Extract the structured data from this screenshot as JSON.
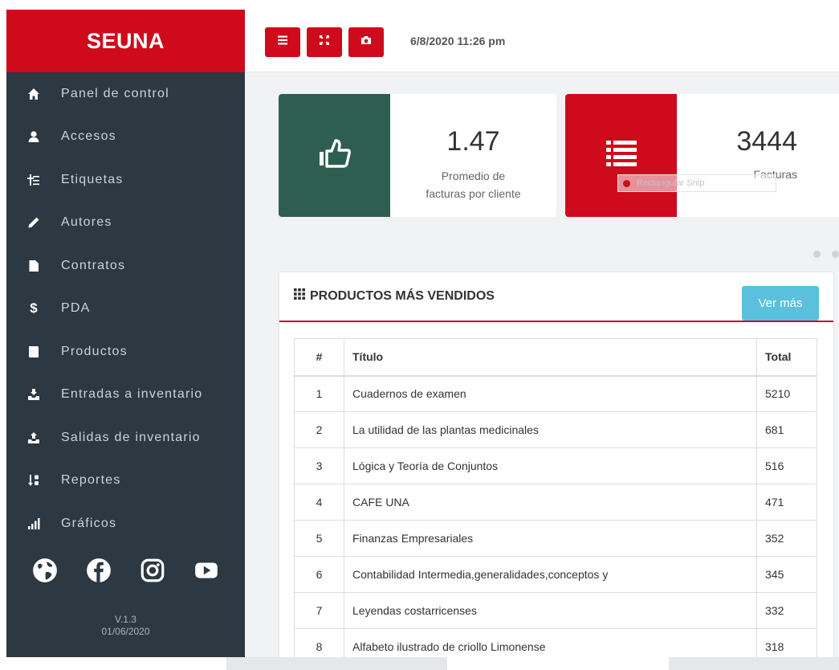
{
  "brand": {
    "name": "SEUNA"
  },
  "sidebar": {
    "items": [
      {
        "label": "Panel de control",
        "icon": "home-icon"
      },
      {
        "label": "Accesos",
        "icon": "user-icon"
      },
      {
        "label": "Etiquetas",
        "icon": "tag-icon"
      },
      {
        "label": "Autores",
        "icon": "pencil-icon"
      },
      {
        "label": "Contratos",
        "icon": "file-icon"
      },
      {
        "label": "PDA",
        "icon": "dollar-icon"
      },
      {
        "label": "Productos",
        "icon": "book-icon"
      },
      {
        "label": "Entradas a inventario",
        "icon": "inbox-in-icon"
      },
      {
        "label": "Salidas de inventario",
        "icon": "inbox-out-icon"
      },
      {
        "label": "Reportes",
        "icon": "sort-icon"
      },
      {
        "label": "Gráficos",
        "icon": "bar-chart-icon"
      }
    ],
    "social": [
      "globe-icon",
      "facebook-icon",
      "instagram-icon",
      "youtube-icon"
    ],
    "version": "V.1.3",
    "version_date": "01/06/2020"
  },
  "topbar": {
    "buttons": [
      "menu-icon",
      "expand-icon",
      "camera-icon"
    ],
    "datetime": "6/8/2020 11:26 pm"
  },
  "cards": [
    {
      "value": "1.47",
      "caption_line1": "Promedio de",
      "caption_line2": "facturas por cliente",
      "icon": "thumbs-up-icon",
      "color": "#2d5e4f"
    },
    {
      "value": "3444",
      "caption": "Facturas",
      "icon": "list-icon",
      "color": "#cf0a1c"
    }
  ],
  "snip": {
    "label": "Rectangular Snip"
  },
  "panel": {
    "title": "PRODUCTOS MÁS VENDIDOS",
    "more_label": "Ver más",
    "columns": [
      "#",
      "Título",
      "Total"
    ],
    "rows": [
      [
        "1",
        "Cuadernos de examen",
        "5210"
      ],
      [
        "2",
        "La utilidad de las plantas medicinales",
        "681"
      ],
      [
        "3",
        "Lógica y Teoría de Conjuntos",
        "516"
      ],
      [
        "4",
        "CAFE UNA",
        "471"
      ],
      [
        "5",
        "Finanzas Empresariales",
        "352"
      ],
      [
        "6",
        "Contabilidad Intermedia,generalidades,conceptos y",
        "345"
      ],
      [
        "7",
        "Leyendas costarricenses",
        "332"
      ],
      [
        "8",
        "Alfabeto ilustrado de criollo Limonense",
        "318"
      ]
    ]
  },
  "colors": {
    "brand_red": "#cf0a1c",
    "sidebar_bg": "#2c3842",
    "accent_green": "#2d5e4f",
    "info_blue": "#5bc0de"
  }
}
